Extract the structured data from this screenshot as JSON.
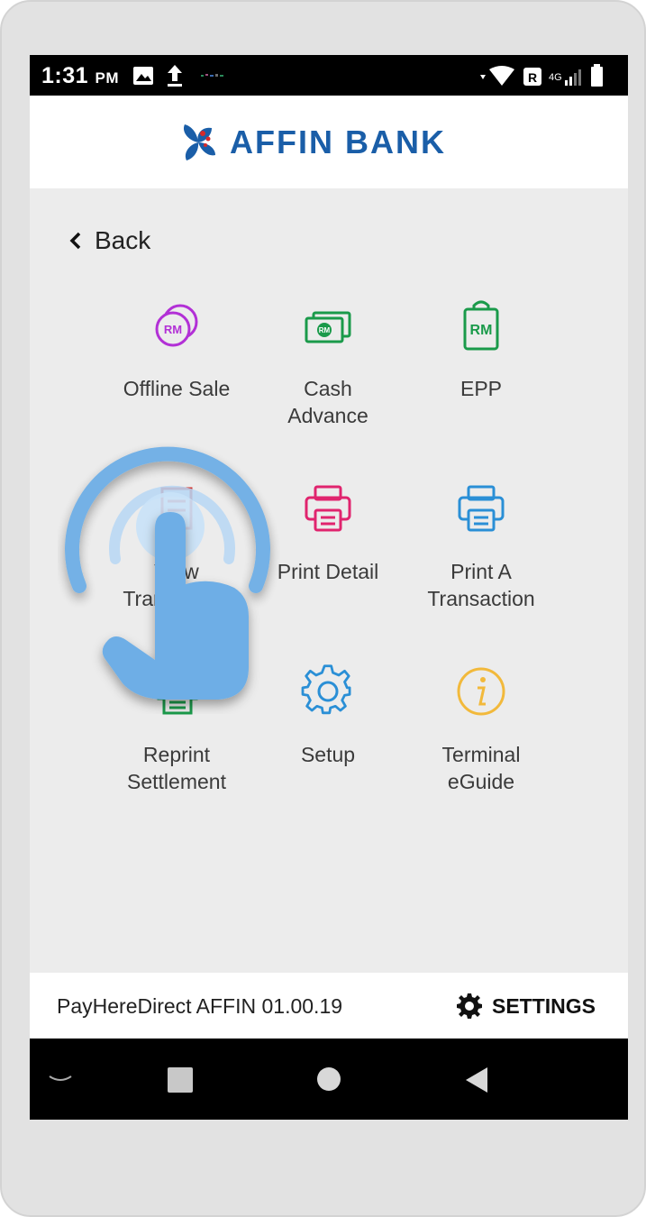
{
  "status_bar": {
    "time": "1:31",
    "ampm": "PM",
    "network": "4G"
  },
  "header": {
    "logo_text": "AFFIN BANK"
  },
  "back": {
    "label": "Back"
  },
  "menu": [
    {
      "label": "Offline Sale",
      "icon": "rm-coins-icon",
      "color": "#b230d6"
    },
    {
      "label": "Cash\nAdvance",
      "icon": "cash-note-icon",
      "color": "#1a9a4a"
    },
    {
      "label": "EPP",
      "icon": "rm-clipboard-icon",
      "color": "#1a9a4a"
    },
    {
      "label": "View\nTransaction",
      "icon": "receipt-icon",
      "color": "#d0302a"
    },
    {
      "label": "Print Detail",
      "icon": "printer-icon",
      "color": "#e0246e"
    },
    {
      "label": "Print A\nTransaction",
      "icon": "printer-icon",
      "color": "#2a8fd6"
    },
    {
      "label": "Reprint\nSettlement",
      "icon": "printer-stack-icon",
      "color": "#1a9a4a"
    },
    {
      "label": "Setup",
      "icon": "gear-icon",
      "color": "#2a8fd6"
    },
    {
      "label": "Terminal\neGuide",
      "icon": "info-icon",
      "color": "#f2b93b"
    }
  ],
  "footer": {
    "version": "PayHereDirect AFFIN 01.00.19",
    "settings_label": "SETTINGS"
  },
  "colors": {
    "brand": "#1a5ea8",
    "tap_overlay": "#6eaee6"
  }
}
